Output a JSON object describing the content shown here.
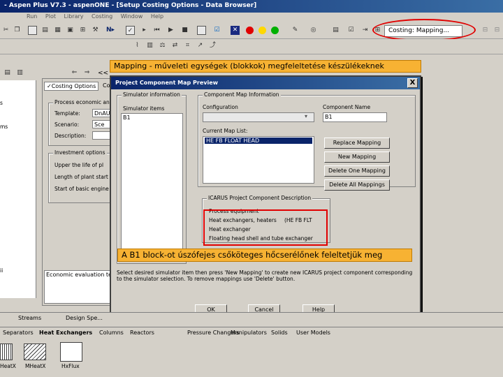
{
  "window": {
    "title": "- Aspen Plus V7.3 - aspenONE - [Setup Costing Options - Data Browser]"
  },
  "menu": [
    "Run",
    "Plot",
    "Library",
    "Costing",
    "Window",
    "Help"
  ],
  "toolbar": {
    "costing_combo": "Costing: Mapping...",
    "icon_label": "N▸"
  },
  "banners": {
    "top": "Mapping - műveleti egységek (blokkok) megfeleltetése készülékeknek",
    "bottom": "A B1 block-ot úszófejes csőköteges hőcserélőnek feleltetjük meg"
  },
  "background_form": {
    "tab_costing": "Costing Options",
    "tab_other": "Co",
    "process_group": "Process economic an",
    "template_label": "Template:",
    "template_value": "DnAU",
    "scenario_label": "Scenario:",
    "scenario_value": "Sce",
    "description_label": "Description:",
    "investment_group": "Investment options",
    "upper_life": "Upper the life of pl",
    "length_plant": "Length of plant start",
    "start_basic": "Start of basic engine",
    "economic_eval": "Economic evaluation temp",
    "nav_back": "<<"
  },
  "dialog": {
    "title": "Project Component Map Preview",
    "close": "X",
    "simulator_info_group": "Simulator information",
    "simulator_items_label": "Simulator items",
    "simulator_items": [
      "B1"
    ],
    "component_map_group": "Component Map Information",
    "configuration_label": "Configuration",
    "configuration_value": "",
    "component_name_label": "Component Name",
    "component_name_value": "B1",
    "current_map_label": "Current Map List:",
    "current_map_items": [
      "HE FB FLOAT HEAD"
    ],
    "buttons": {
      "replace": "Replace Mapping",
      "new": "New Mapping",
      "delete_one": "Delete One Mapping",
      "delete_all": "Delete All Mappings",
      "ok": "OK",
      "cancel": "Cancel",
      "help": "Help"
    },
    "icarus_group": "ICARUS Project Component Description",
    "icarus_lines": [
      "Process equipment",
      "Heat exchangers, heaters",
      "Heat exchanger",
      "Floating head shell and tube exchanger"
    ],
    "icarus_code": "(HE FB FLT",
    "hint": "Select desired simulator item then press 'New Mapping' to create new ICARUS project component corresponding to the simulator selection. To remove mappings use 'Delete' button."
  },
  "bottom_tabs": [
    "Streams",
    "Design Spe..."
  ],
  "library_tabs": [
    "Separators",
    "Heat Exchangers",
    "Columns",
    "Reactors",
    "Pressure Changers",
    "Manipulators",
    "Solids",
    "User Models"
  ],
  "library_items": [
    "HeatX",
    "MHeatX",
    "HxFlux"
  ]
}
